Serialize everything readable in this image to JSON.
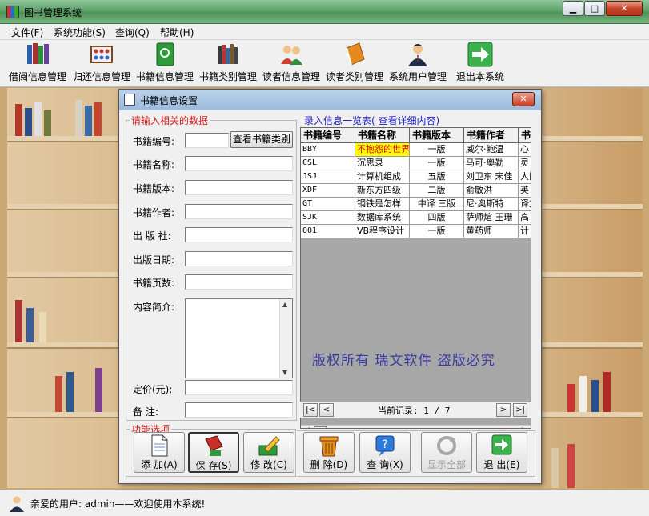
{
  "window": {
    "title": "图书管理系统",
    "min": "▁",
    "max": "□",
    "close": "✕"
  },
  "menu": [
    {
      "label": "文件(F)"
    },
    {
      "label": "系统功能(S)"
    },
    {
      "label": "查询(Q)"
    },
    {
      "label": "帮助(H)"
    }
  ],
  "toolbar": [
    {
      "label": "借阅信息管理",
      "icon": "books-icon"
    },
    {
      "label": "归还信息管理",
      "icon": "abacus-icon"
    },
    {
      "label": "书籍信息管理",
      "icon": "green-book-icon"
    },
    {
      "label": "书籍类别管理",
      "icon": "bookshelf-icon"
    },
    {
      "label": "读者信息管理",
      "icon": "users-icon"
    },
    {
      "label": "读者类别管理",
      "icon": "orange-book-icon"
    },
    {
      "label": "系统用户管理",
      "icon": "admin-user-icon"
    },
    {
      "label": "退出本系统",
      "icon": "exit-arrow-icon"
    }
  ],
  "dialog": {
    "title": "书籍信息设置",
    "close": "✕",
    "input_group": {
      "legend": "请输入相关的数据",
      "view_category_button": "查看书籍类别",
      "fields": {
        "code": "书籍编号:",
        "name": "书籍名称:",
        "edition": "书籍版本:",
        "author": "书籍作者:",
        "publisher": "出 版 社:",
        "pubdate": "出版日期:",
        "pages": "书籍页数:",
        "summary": "内容简介:",
        "price": "定价(元):",
        "remark": "备    注:"
      }
    },
    "list": {
      "legend": "录入信息一览表(      查看详细内容)",
      "columns": [
        "书籍编号",
        "书籍名称",
        "书籍版本",
        "书籍作者",
        "书"
      ],
      "rows": [
        [
          "BBY",
          "不抱怨的世界",
          "一版",
          "威尔·鲍温",
          "心"
        ],
        [
          "CSL",
          "沉思录",
          "一版",
          "马可·奥勒",
          "灵"
        ],
        [
          "JSJ",
          "计算机组成",
          "五版",
          "刘卫东 宋佳",
          "人民"
        ],
        [
          "XDF",
          "新东方四级",
          "二版",
          "俞敏洪",
          "英"
        ],
        [
          "GT",
          "钢铁是怎样",
          "中译 三版",
          "尼·奥斯特",
          "译文"
        ],
        [
          "SJK",
          "数据库系统",
          "四版",
          "萨师煊 王珊",
          "高"
        ],
        [
          "001",
          "VB程序设计",
          "一版",
          "黄药师",
          "计"
        ]
      ],
      "copyright": "版权所有  瑞文软件  盗版必究",
      "nav": {
        "first": "|<",
        "prev": "<",
        "next": ">",
        "last": ">|",
        "record": "当前记录: 1 / 7"
      }
    },
    "actions": {
      "legend": "功能选项",
      "buttons": [
        {
          "label": "添 加(A)",
          "icon": "add-document-icon",
          "enabled": true
        },
        {
          "label": "保 存(S)",
          "icon": "save-floppy-icon",
          "enabled": true
        },
        {
          "label": "修 改(C)",
          "icon": "edit-pencil-icon",
          "enabled": true
        },
        {
          "label": "删 除(D)",
          "icon": "trash-can-icon",
          "enabled": true
        },
        {
          "label": "查 询(X)",
          "icon": "help-query-icon",
          "enabled": true
        },
        {
          "label": "显示全部",
          "icon": "refresh-icon",
          "enabled": false
        },
        {
          "label": "退 出(E)",
          "icon": "exit-arrow-icon",
          "enabled": true
        }
      ]
    }
  },
  "status": {
    "text": "亲爱的用户: admin——欢迎使用本系统!"
  }
}
